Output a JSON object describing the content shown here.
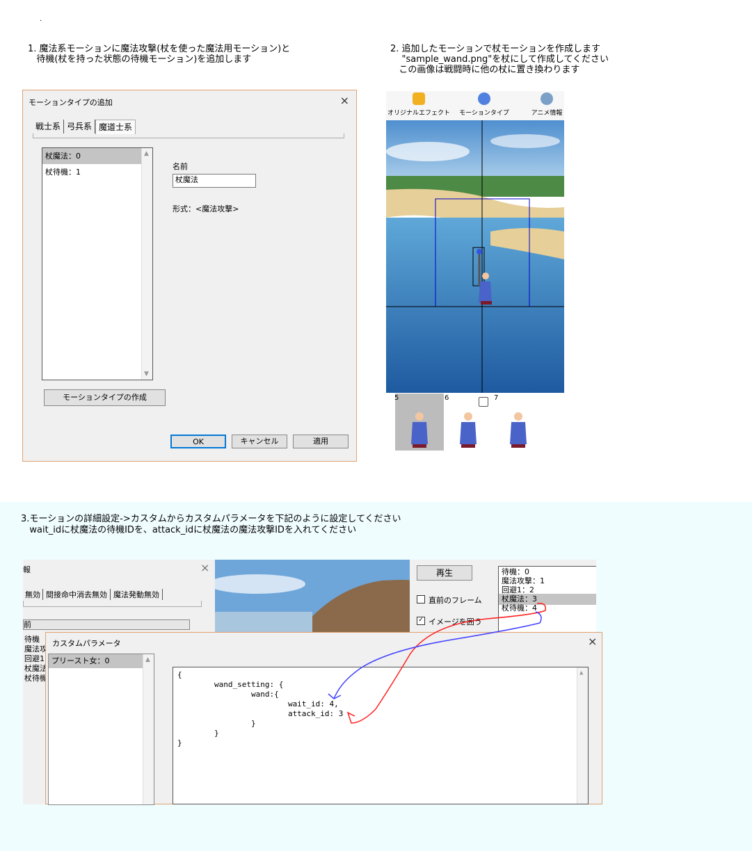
{
  "dot": ".",
  "instructions": {
    "step1_line1": "1. 魔法系モーションに魔法攻撃(杖を使った魔法用モーション)と",
    "step1_line2": "   待機(杖を持った状態の待機モーション)を追加します",
    "step2_line1": "2. 追加したモーションで杖モーションを作成します",
    "step2_line2": "    \"sample_wand.png\"を杖にして作成してください",
    "step2_line3": "   この画像は戦闘時に他の杖に置き換わります",
    "step3_line1": "3.モーションの詳細設定->カスタムからカスタムパラメータを下記のように設定してください",
    "step3_line2": "   wait_idに杖魔法の待機IDを、attack_idに杖魔法の魔法攻撃IDを入れてください"
  },
  "motion_type_dialog": {
    "title": "モーションタイプの追加",
    "close": "×",
    "tabs": [
      "戦士系",
      "弓兵系",
      "魔道士系"
    ],
    "list_items": [
      "杖魔法：0",
      "杖待機：1"
    ],
    "name_label": "名前",
    "name_value": "杖魔法",
    "format_label": "形式：<魔法攻撃>",
    "create_button": "モーションタイプの作成",
    "ok_button": "OK",
    "cancel_button": "キャンセル",
    "apply_button": "適用"
  },
  "editor_toolbar": {
    "items": [
      "オリジナルエフェクト",
      "モーションタイプ",
      "アニメ情報"
    ]
  },
  "frame_strip": {
    "numbers": [
      "5",
      "6",
      "7"
    ]
  },
  "anim_info_window": {
    "title_fragment": "報",
    "close": "×",
    "tabs": [
      "無効",
      "間接命中消去無効",
      "魔法発動無効"
    ],
    "list_fragments": [
      "前",
      "待機",
      "魔法攻",
      "回避1",
      "杖魔法",
      "杖待機"
    ],
    "play_button": "再生",
    "prev_frame_label": "直前のフレーム",
    "image_enclose_label": "イメージを囲う",
    "motions": [
      "待機：0",
      "魔法攻撃：1",
      "回避1：2",
      "杖魔法：3",
      "杖待機：4"
    ]
  },
  "custom_param_dialog": {
    "title": "カスタムパラメータ",
    "close": "×",
    "list_items": [
      "プリースト女：0"
    ],
    "code_lines": [
      "{",
      "        wand_setting: {",
      "                wand:{",
      "                        wait_id: 4,",
      "                        attack_id: 3",
      "                }",
      "        }",
      "}"
    ]
  },
  "colors": {
    "dialog_bg": "#f0f0f0",
    "dialog_border": "#e0a070",
    "selection": "#c4c4c4",
    "annotation_red": "#ff2020",
    "annotation_blue": "#4040ff",
    "lower_bg": "#f0fdff"
  }
}
